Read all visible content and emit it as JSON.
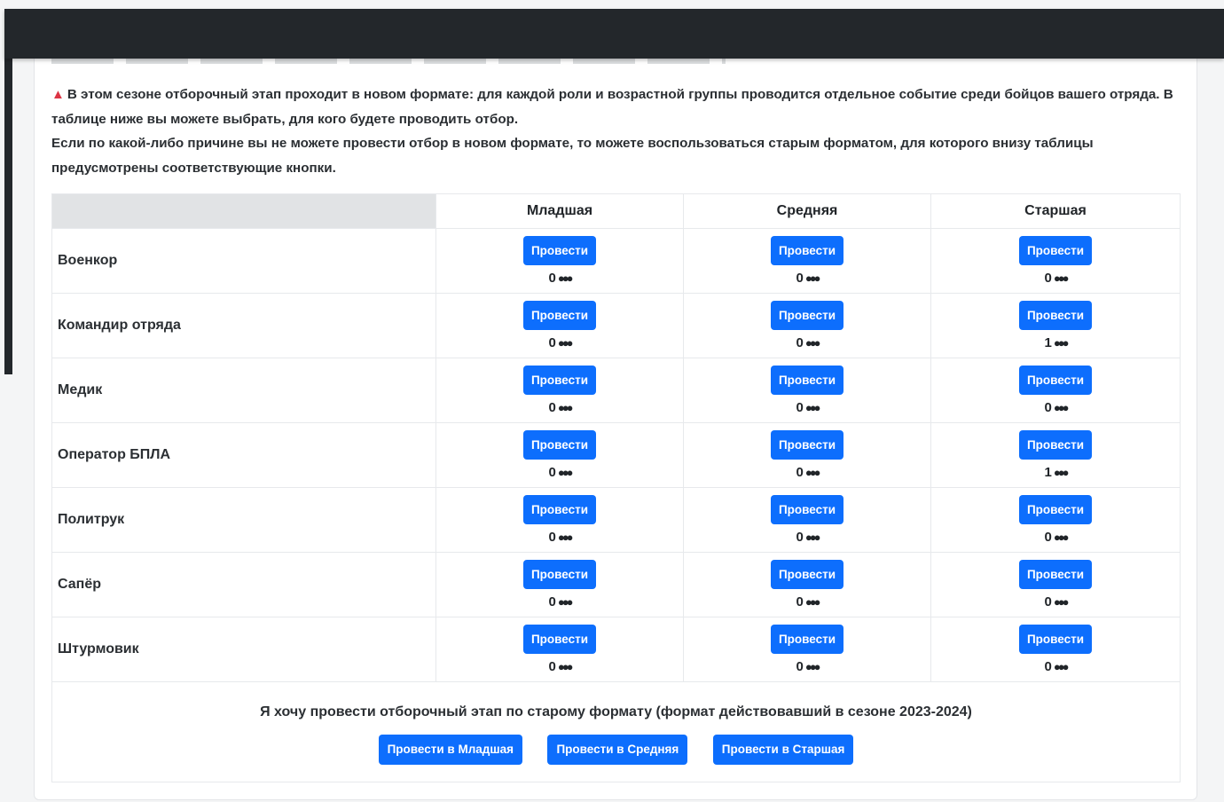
{
  "notice": {
    "line1": "В этом сезоне отборочный этап проходит в новом формате: для каждой роли и возрастной группы проводится отдельное событие среди бойцов вашего отряда. В таблице ниже вы можете выбрать, для кого будете проводить отбор.",
    "line2": "Если по какой-либо причине вы не можете провести отбор в новом формате, то можете воспользоваться старым форматом, для которого внизу таблицы предусмотрены соответствующие кнопки.",
    "icon": "warning-icon",
    "icon_color": "#dc3545"
  },
  "table": {
    "columns": [
      "Младшая",
      "Средняя",
      "Старшая"
    ],
    "button_label": "Провести",
    "rows": [
      {
        "role": "Военкор",
        "counts": [
          "0",
          "0",
          "0"
        ]
      },
      {
        "role": "Командир отряда",
        "counts": [
          "0",
          "0",
          "1"
        ]
      },
      {
        "role": "Медик",
        "counts": [
          "0",
          "0",
          "0"
        ]
      },
      {
        "role": "Оператор БПЛА",
        "counts": [
          "0",
          "0",
          "1"
        ]
      },
      {
        "role": "Политрук",
        "counts": [
          "0",
          "0",
          "0"
        ]
      },
      {
        "role": "Сапёр",
        "counts": [
          "0",
          "0",
          "0"
        ]
      },
      {
        "role": "Штурмовик",
        "counts": [
          "0",
          "0",
          "0"
        ]
      }
    ],
    "count_icon": "people-group-icon"
  },
  "old_format": {
    "text": "Я хочу провести отборочный этап по старому формату (формат действовавший в сезоне 2023-2024)",
    "buttons": [
      "Провести в Младшая",
      "Провести в Средняя",
      "Провести в Старшая"
    ]
  },
  "colors": {
    "primary": "#0d6efd",
    "topbar": "#23272b"
  }
}
